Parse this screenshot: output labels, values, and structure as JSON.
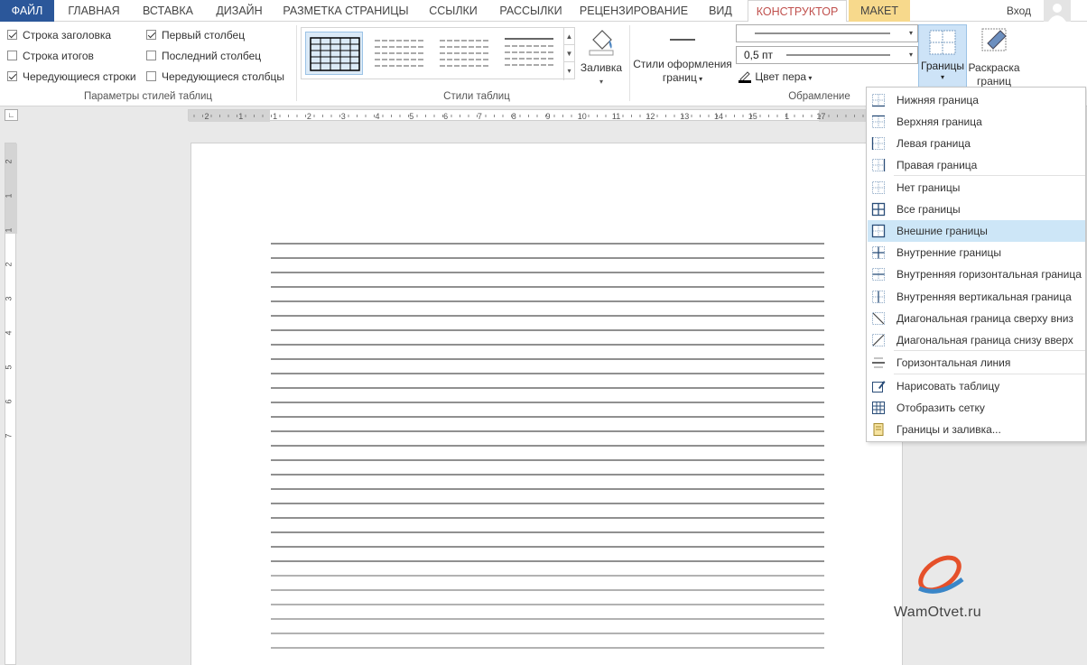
{
  "tabs": {
    "file": "ФАЙЛ",
    "home": "ГЛАВНАЯ",
    "insert": "ВСТАВКА",
    "design": "ДИЗАЙН",
    "layout_page": "РАЗМЕТКА СТРАНИЦЫ",
    "references": "ССЫЛКИ",
    "mailings": "РАССЫЛКИ",
    "review": "РЕЦЕНЗИРОВАНИЕ",
    "view": "ВИД",
    "constructor": "КОНСТРУКТОР",
    "maket": "МАКЕТ",
    "login": "Вход"
  },
  "style_options": {
    "group_label": "Параметры стилей таблиц",
    "items": [
      {
        "label": "Строка заголовка",
        "checked": true
      },
      {
        "label": "Строка итогов",
        "checked": false
      },
      {
        "label": "Чередующиеся строки",
        "checked": true
      },
      {
        "label": "Первый столбец",
        "checked": true
      },
      {
        "label": "Последний столбец",
        "checked": false
      },
      {
        "label": "Чередующиеся столбцы",
        "checked": false
      }
    ]
  },
  "table_styles": {
    "group_label": "Стили таблиц",
    "shading": "Заливка"
  },
  "borders_group": {
    "group_label": "Обрамление",
    "border_styles_line1": "Стили оформления",
    "border_styles_line2": "границ",
    "weight": "0,5 пт",
    "pen_color": "Цвет пера",
    "borders_btn": "Границы",
    "painter_line1": "Раскраска",
    "painter_line2": "границ"
  },
  "ruler": {
    "h_marks": [
      "2",
      "1",
      "1",
      "2",
      "3",
      "4",
      "5",
      "6",
      "7",
      "8",
      "9",
      "10",
      "11",
      "12",
      "13",
      "14",
      "15",
      "1",
      "17"
    ],
    "v_marks": [
      "2",
      "1",
      "1",
      "2",
      "3",
      "4",
      "5",
      "6",
      "7"
    ]
  },
  "menu": {
    "items": [
      {
        "label": "Нижняя граница",
        "icon": "bottom-border-icon"
      },
      {
        "label": "Верхняя граница",
        "icon": "top-border-icon"
      },
      {
        "label": "Левая граница",
        "icon": "left-border-icon"
      },
      {
        "label": "Правая граница",
        "icon": "right-border-icon"
      },
      {
        "label": "Нет границы",
        "icon": "no-border-icon"
      },
      {
        "label": "Все границы",
        "icon": "all-borders-icon"
      },
      {
        "label": "Внешние границы",
        "icon": "outside-borders-icon"
      },
      {
        "label": "Внутренние границы",
        "icon": "inside-borders-icon"
      },
      {
        "label": "Внутренняя горизонтальная граница",
        "icon": "inside-horizontal-border-icon"
      },
      {
        "label": "Внутренняя вертикальная граница",
        "icon": "inside-vertical-border-icon"
      },
      {
        "label": "Диагональная граница сверху вниз",
        "icon": "diagonal-down-border-icon"
      },
      {
        "label": "Диагональная граница снизу вверх",
        "icon": "diagonal-up-border-icon"
      },
      {
        "label": "Горизонтальная линия",
        "icon": "horizontal-line-icon"
      },
      {
        "label": "Нарисовать таблицу",
        "icon": "draw-table-icon"
      },
      {
        "label": "Отобразить сетку",
        "icon": "view-gridlines-icon"
      },
      {
        "label": "Границы и заливка...",
        "icon": "borders-shading-icon"
      }
    ],
    "highlighted": "Внешние границы"
  },
  "watermark": {
    "text": "WamOtvet.ru"
  },
  "colors": {
    "file_tab": "#2b579a",
    "context_tab": "#c0504d",
    "highlight": "#cde6f7"
  }
}
